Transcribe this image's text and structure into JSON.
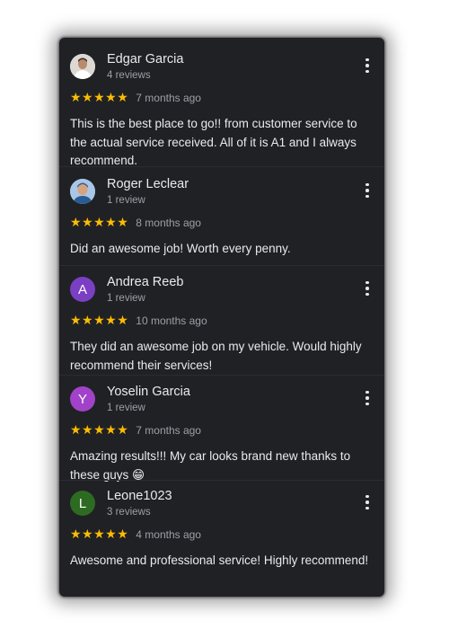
{
  "reviews": [
    {
      "name": "Edgar Garcia",
      "count": "4 reviews",
      "stars": "★★★★★",
      "age": "7 months ago",
      "text": "This is the best place to go!! from customer service to the actual service received. All of it is A1 and I always recommend.",
      "avatar": {
        "type": "photo",
        "icon": "person-photo"
      }
    },
    {
      "name": "Roger Leclear",
      "count": "1 review",
      "stars": "★★★★★",
      "age": "8 months ago",
      "text": "Did an awesome job! Worth every penny.",
      "avatar": {
        "type": "photo",
        "icon": "person-photo"
      }
    },
    {
      "name": "Andrea Reeb",
      "count": "1 review",
      "stars": "★★★★★",
      "age": "10 months ago",
      "text": "They did an awesome job on my vehicle. Would highly recommend their services!",
      "avatar": {
        "type": "letter",
        "letter": "A",
        "color": "#7b3fc4"
      }
    },
    {
      "name": "Yoselin Garcia",
      "count": "1 review",
      "stars": "★★★★★",
      "age": "7 months ago",
      "text": "Amazing results!!! My car looks brand new thanks to these guys 😁",
      "avatar": {
        "type": "letter",
        "letter": "Y",
        "color": "#a142c9"
      }
    },
    {
      "name": "Leone1023",
      "count": "3 reviews",
      "stars": "★★★★★",
      "age": "4 months ago",
      "text": "Awesome and professional service! Highly recommend!",
      "avatar": {
        "type": "letter",
        "letter": "L",
        "color": "#2e6b22"
      }
    }
  ],
  "colors": {
    "background": "#202124",
    "text": "#e8eaed",
    "secondary": "#9aa0a6",
    "star": "#fbbc04"
  }
}
